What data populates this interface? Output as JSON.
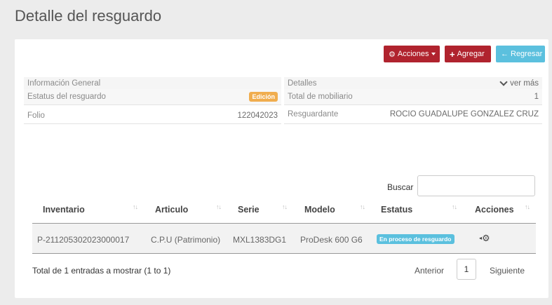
{
  "page": {
    "title": "Detalle del resguardo"
  },
  "toolbar": {
    "acciones": "Acciones",
    "agregar": "Agregar",
    "regresar": "Regresar"
  },
  "general": {
    "heading": "Información General",
    "status_label": "Estatus del resguardo",
    "status_badge": "Edición",
    "folio_label": "Folio",
    "folio_value": "122042023"
  },
  "details": {
    "heading": "Detalles",
    "ver_mas": "ver más",
    "total_label": "Total de mobiliario",
    "total_value": "1",
    "resguardante_label": "Resguardante",
    "resguardante_value": "ROCIO GUADALUPE GONZALEZ CRUZ"
  },
  "search": {
    "label": "Buscar",
    "value": ""
  },
  "table": {
    "columns": [
      "Inventario",
      "Articulo",
      "Serie",
      "Modelo",
      "Estatus",
      "Acciones"
    ],
    "rows": [
      {
        "inventario": "P-211205302023000017",
        "articulo": "C.P.U (Patrimonio)",
        "serie": "MXL1383DG1",
        "modelo": "ProDesk 600 G6",
        "estatus": "En proceso de resguardo"
      }
    ]
  },
  "pagination": {
    "info": "Total de 1 entradas a mostrar (1 to 1)",
    "prev": "Anterior",
    "page": "1",
    "next": "Siguiente"
  },
  "colors": {
    "primary": "#b0232e",
    "info": "#5bc0de",
    "warning": "#f0ad4e"
  },
  "icons": {
    "acciones": "gear-icon",
    "agregar": "plus-icon",
    "regresar": "arrow-left-icon",
    "ver_mas": "chevron-down-icon",
    "row_action": "gear-icon"
  }
}
